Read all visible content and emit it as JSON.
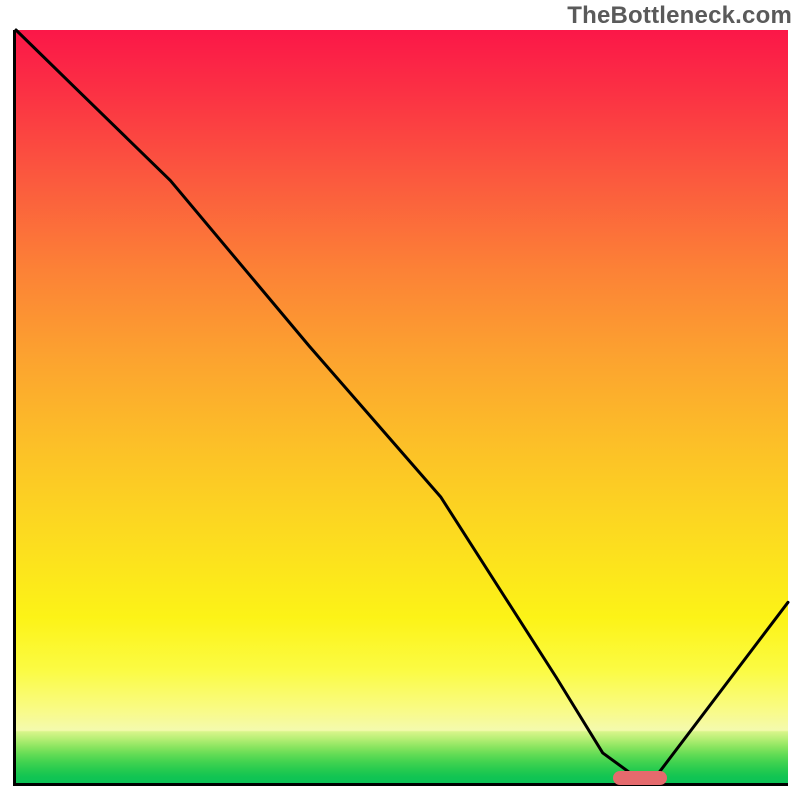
{
  "watermark": "TheBottleneck.com",
  "chart_data": {
    "type": "line",
    "title": "",
    "xlabel": "",
    "ylabel": "",
    "xlim": [
      0,
      100
    ],
    "ylim": [
      0,
      100
    ],
    "grid": false,
    "series": [
      {
        "name": "bottleneck-curve",
        "x": [
          0,
          8,
          20,
          38,
          55,
          70,
          76,
          80,
          83,
          100
        ],
        "values": [
          100,
          92,
          80,
          58,
          38,
          14,
          4,
          1,
          1,
          24
        ]
      }
    ],
    "optimum_marker": {
      "x_start": 77,
      "x_end": 84,
      "y": 1
    },
    "background_gradient": {
      "stops": [
        {
          "pos": 0,
          "color": "#fb1748"
        },
        {
          "pos": 32,
          "color": "#fc8236"
        },
        {
          "pos": 68,
          "color": "#fcdd1f"
        },
        {
          "pos": 90,
          "color": "#f9fb82"
        },
        {
          "pos": 100,
          "color": "#0bc256"
        }
      ]
    }
  },
  "colors": {
    "curve": "#000000",
    "marker": "#e56a6d",
    "axis": "#000000"
  }
}
